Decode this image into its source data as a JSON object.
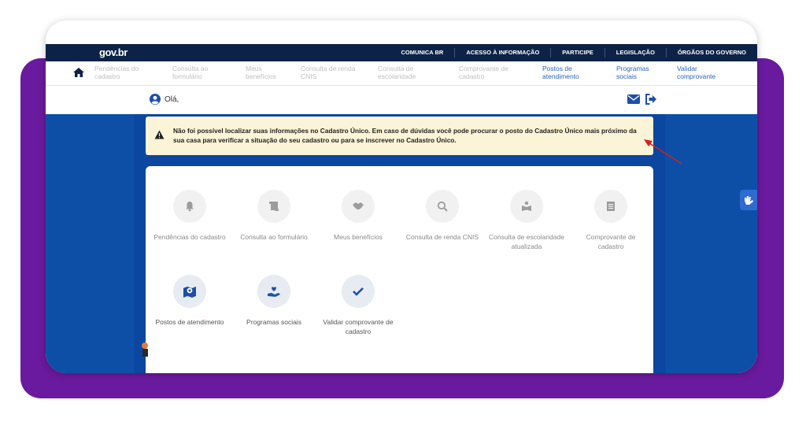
{
  "header": {
    "logo": "gov.br",
    "links": [
      "COMUNICA BR",
      "ACESSO À INFORMAÇÃO",
      "PARTICIPE",
      "LEGISLAÇÃO",
      "ÓRGÃOS DO GOVERNO"
    ]
  },
  "nav": {
    "items": [
      {
        "label": "Pendências do cadastro"
      },
      {
        "label": "Consulta ao formulário"
      },
      {
        "label": "Meus benefícios"
      },
      {
        "label": "Consulta de renda CNIS"
      },
      {
        "label": "Consulta de escolaridade"
      },
      {
        "label": "Comprovante de cadastro"
      },
      {
        "label": "Postos de atendimento"
      },
      {
        "label": "Programas sociais"
      },
      {
        "label": "Validar comprovante"
      }
    ]
  },
  "user": {
    "greeting": "Olá,"
  },
  "alert": {
    "text": "Não foi possível localizar suas informações no Cadastro Único. Em caso de dúvidas você pode procurar o posto do Cadastro Único mais próximo da sua casa para verificar a situação do seu cadastro ou para se inscrever no Cadastro Único."
  },
  "services": [
    {
      "label": "Pendências do cadastro",
      "icon": "bell-icon"
    },
    {
      "label": "Consulta ao formulário",
      "icon": "scroll-icon"
    },
    {
      "label": "Meus benefícios",
      "icon": "handshake-icon"
    },
    {
      "label": "Consulta de renda CNIS",
      "icon": "search-icon"
    },
    {
      "label": "Consulta de escolaridade atualizada",
      "icon": "book-reader-icon"
    },
    {
      "label": "Comprovante de cadastro",
      "icon": "receipt-icon"
    },
    {
      "label": "Postos de atendimento",
      "icon": "map-marker-icon"
    },
    {
      "label": "Programas sociais",
      "icon": "hand-heart-icon"
    },
    {
      "label": "Validar comprovante de cadastro",
      "icon": "check-icon"
    }
  ],
  "colors": {
    "topbar": "#0c2347",
    "accent": "#2b63c9",
    "content_bg": "#0d4fa6",
    "alert_bg": "#fcf4d7",
    "frame": "#6a1a9e"
  }
}
